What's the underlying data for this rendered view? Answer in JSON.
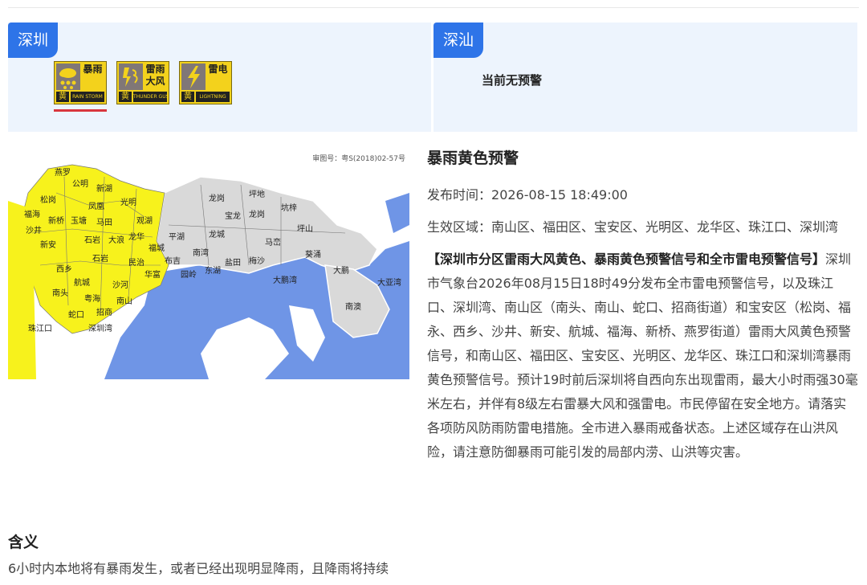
{
  "shenzhen": {
    "city": "深圳",
    "warnings": [
      {
        "name": "暴雨",
        "level": "黄",
        "en": "RAIN STORM",
        "icon": "rainstorm-icon",
        "active": true
      },
      {
        "name": "雷雨大风",
        "level": "黄",
        "en": "THUNDER GUST",
        "icon": "thunder-gust-icon",
        "active": false
      },
      {
        "name": "雷电",
        "level": "黄",
        "en": "LIGHTNING",
        "icon": "lightning-icon",
        "active": false
      }
    ]
  },
  "shenshan": {
    "city": "深汕",
    "status": "当前无预警"
  },
  "map": {
    "approval_no": "审图号：粤S(2018)02-57号",
    "labels": [
      "燕罗",
      "公明",
      "新湖",
      "松岗",
      "福海",
      "凤凰",
      "光明",
      "沙井",
      "新桥",
      "玉塘",
      "马田",
      "观湖",
      "龙城",
      "坪地",
      "新安",
      "石岩",
      "大浪",
      "龙华",
      "福城",
      "布吉",
      "龙岗",
      "坑梓",
      "西乡",
      "航城",
      "石岩",
      "民治",
      "平湖",
      "宝龙",
      "坪山",
      "南湾",
      "东湖",
      "龙岗",
      "马峦",
      "葵涌",
      "大鹏",
      "南头",
      "粤海",
      "沙河",
      "华富",
      "园岭",
      "盐田",
      "梅沙",
      "大鹏湾",
      "大亚湾",
      "南澳",
      "深圳湾",
      "珠江口",
      "蛇口",
      "招商",
      "南山"
    ],
    "colors": {
      "warning": "#f7f21c",
      "land": "#d9d9d9",
      "sea": "#6f95e6"
    }
  },
  "detail": {
    "title": "暴雨黄色预警",
    "publish_label": "发布时间：",
    "publish_time": "2026-08-15 18:49:00",
    "area_label": "生效区域：",
    "area": "南山区、福田区、宝安区、光明区、龙华区、珠江口、深圳湾",
    "headline": "【深圳市分区雷雨大风黄色、暴雨黄色预警信号和全市雷电预警信号】",
    "body": "深圳市气象台2026年08月15日18时49分发布全市雷电预警信号，以及珠江口、深圳湾、南山区（南头、南山、蛇口、招商街道）和宝安区（松岗、福永、西乡、沙井、新安、航城、福海、新桥、燕罗街道）雷雨大风黄色预警信号，和南山区、福田区、宝安区、光明区、龙华区、珠江口和深圳湾暴雨黄色预警信号。预计19时前后深圳将自西向东出现雷雨，最大小时雨强30毫米左右，并伴有8级左右雷暴大风和强雷电。市民停留在安全地方。请落实各项防风防雨防雷电措施。全市进入暴雨戒备状态。上述区域存在山洪风险，请注意防御暴雨可能引发的局部内涝、山洪等灾害。"
  },
  "meaning": {
    "title": "含义",
    "text": "6小时内本地将有暴雨发生，或者已经出现明显降雨，且降雨将持续"
  }
}
